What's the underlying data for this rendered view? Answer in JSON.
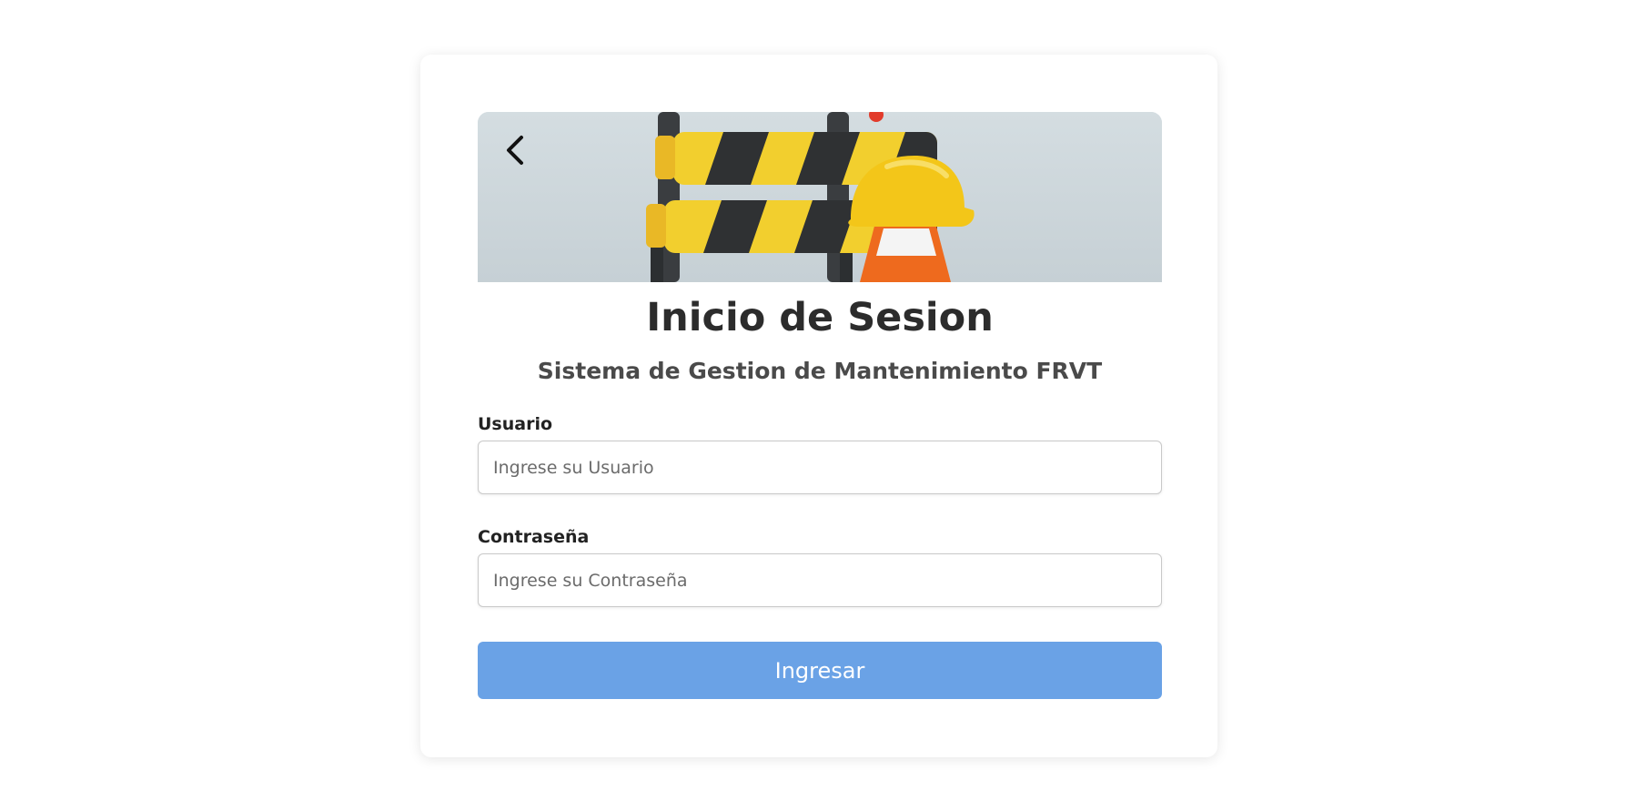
{
  "header": {
    "banner_image": "construction-barrier-helmet-cone",
    "back_icon": "chevron-left-icon"
  },
  "login": {
    "title": "Inicio de Sesion",
    "subtitle": "Sistema de Gestion de Mantenimiento FRVT",
    "username_label": "Usuario",
    "username_value": "",
    "username_placeholder": "Ingrese su Usuario",
    "password_label": "Contraseña",
    "password_value": "",
    "password_placeholder": "Ingrese su Contraseña",
    "submit_label": "Ingresar"
  },
  "colors": {
    "button": "#6aa2e6",
    "title_text": "#2c2c2c",
    "subtitle_text": "#4a4a4a",
    "banner_bg": "#cfd8dd"
  }
}
